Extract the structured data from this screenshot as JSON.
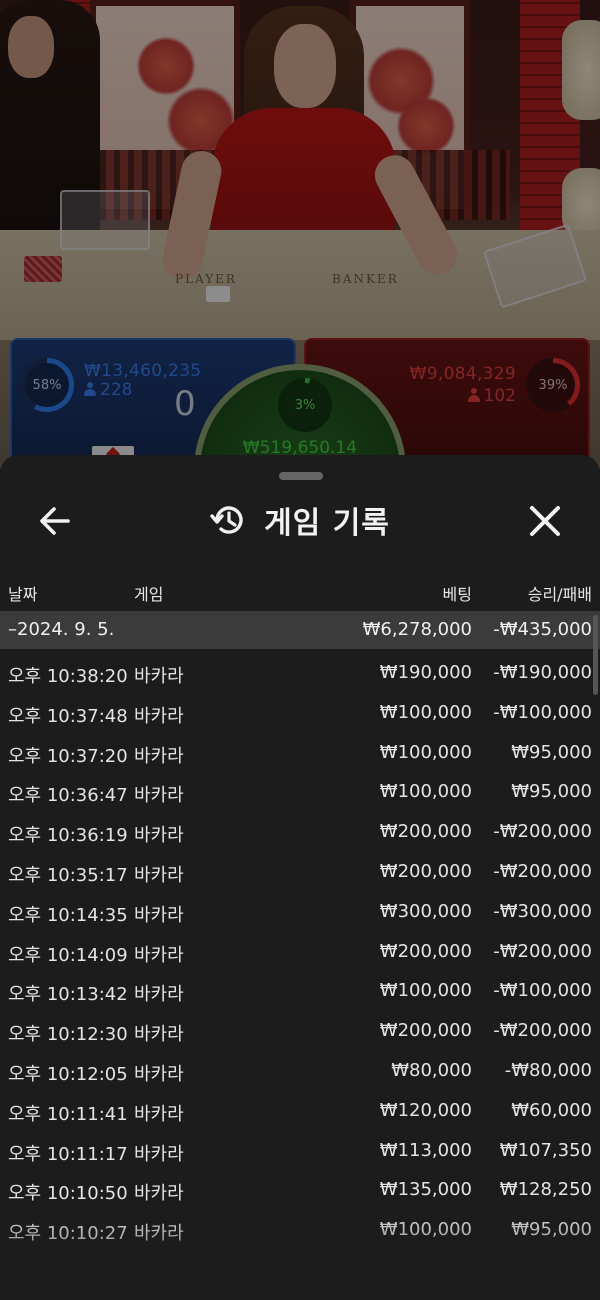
{
  "game": {
    "table_labels": {
      "player": "PLAYER",
      "banker": "BANKER"
    },
    "player": {
      "percent": "58%",
      "amount": "₩13,460,235",
      "bettors": "228",
      "score": "0"
    },
    "banker": {
      "percent": "39%",
      "amount": "₩9,084,329",
      "bettors": "102"
    },
    "tie": {
      "percent": "3%",
      "amount": "₩519,650.14"
    }
  },
  "sheet": {
    "title": "게임 기록",
    "icons": {
      "back": "arrow-left-icon",
      "history": "history-icon",
      "close": "close-icon"
    }
  },
  "table": {
    "headers": {
      "date": "날짜",
      "game": "게임",
      "bet": "베팅",
      "win_loss": "승리/패배"
    },
    "summary": {
      "date": "–2024. 9. 5.",
      "bet": "₩6,278,000",
      "win_loss": "-₩435,000"
    },
    "rows": [
      {
        "time": "오후 10:38:20",
        "game": "바카라",
        "bet": "₩190,000",
        "win_loss": "-₩190,000"
      },
      {
        "time": "오후 10:37:48",
        "game": "바카라",
        "bet": "₩100,000",
        "win_loss": "-₩100,000"
      },
      {
        "time": "오후 10:37:20",
        "game": "바카라",
        "bet": "₩100,000",
        "win_loss": "₩95,000"
      },
      {
        "time": "오후 10:36:47",
        "game": "바카라",
        "bet": "₩100,000",
        "win_loss": "₩95,000"
      },
      {
        "time": "오후 10:36:19",
        "game": "바카라",
        "bet": "₩200,000",
        "win_loss": "-₩200,000"
      },
      {
        "time": "오후 10:35:17",
        "game": "바카라",
        "bet": "₩200,000",
        "win_loss": "-₩200,000"
      },
      {
        "time": "오후 10:14:35",
        "game": "바카라",
        "bet": "₩300,000",
        "win_loss": "-₩300,000"
      },
      {
        "time": "오후 10:14:09",
        "game": "바카라",
        "bet": "₩200,000",
        "win_loss": "-₩200,000"
      },
      {
        "time": "오후 10:13:42",
        "game": "바카라",
        "bet": "₩100,000",
        "win_loss": "-₩100,000"
      },
      {
        "time": "오후 10:12:30",
        "game": "바카라",
        "bet": "₩200,000",
        "win_loss": "-₩200,000"
      },
      {
        "time": "오후 10:12:05",
        "game": "바카라",
        "bet": "₩80,000",
        "win_loss": "-₩80,000"
      },
      {
        "time": "오후 10:11:41",
        "game": "바카라",
        "bet": "₩120,000",
        "win_loss": "₩60,000"
      },
      {
        "time": "오후 10:11:17",
        "game": "바카라",
        "bet": "₩113,000",
        "win_loss": "₩107,350"
      },
      {
        "time": "오후 10:10:50",
        "game": "바카라",
        "bet": "₩135,000",
        "win_loss": "₩128,250"
      },
      {
        "time": "오후 10:10:27",
        "game": "바카라",
        "bet": "₩100,000",
        "win_loss": "₩95,000"
      }
    ]
  },
  "colors": {
    "sheet_bg": "#1c1c1c",
    "summary_bg": "#3b3b3b",
    "player_blue": "#3a7ff0",
    "banker_red": "#e04040",
    "tie_green": "#40d040"
  }
}
